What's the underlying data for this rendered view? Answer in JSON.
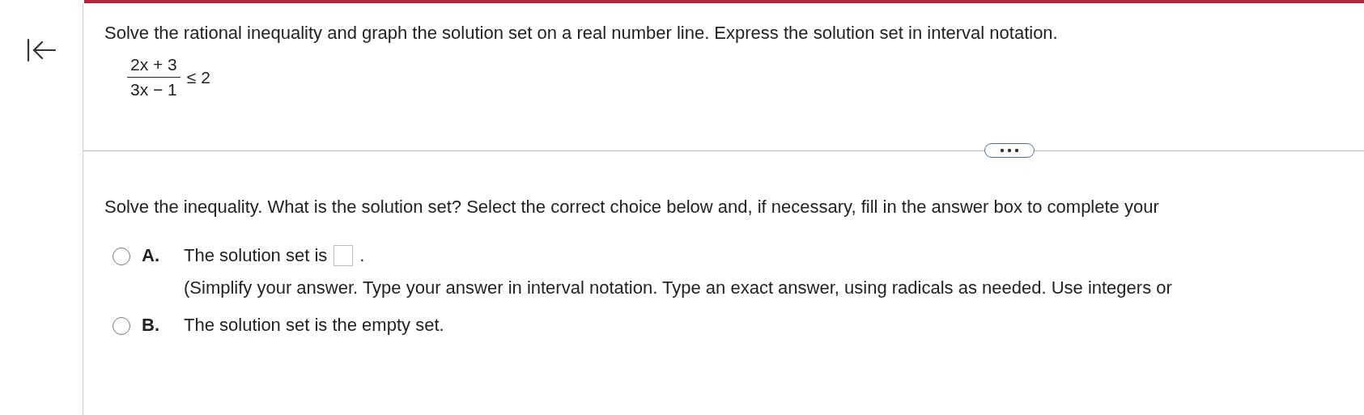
{
  "question": "Solve the rational inequality and graph the solution set on a real number line. Express the solution set in interval notation.",
  "inequality": {
    "numerator": "2x + 3",
    "denominator": "3x − 1",
    "relation": "≤ 2"
  },
  "prompt": "Solve the inequality. What is the solution set? Select the correct choice below and, if necessary, fill in the answer box to complete your",
  "choices": [
    {
      "letter": "A.",
      "kind": "answer_box",
      "text": "The solution set is",
      "after": ".",
      "hint": "(Simplify your answer. Type your answer in interval notation. Type an exact answer, using radicals as needed. Use integers or",
      "selected": false
    },
    {
      "letter": "B.",
      "kind": "plain",
      "text": "The solution set is the empty set.",
      "selected": false
    }
  ]
}
